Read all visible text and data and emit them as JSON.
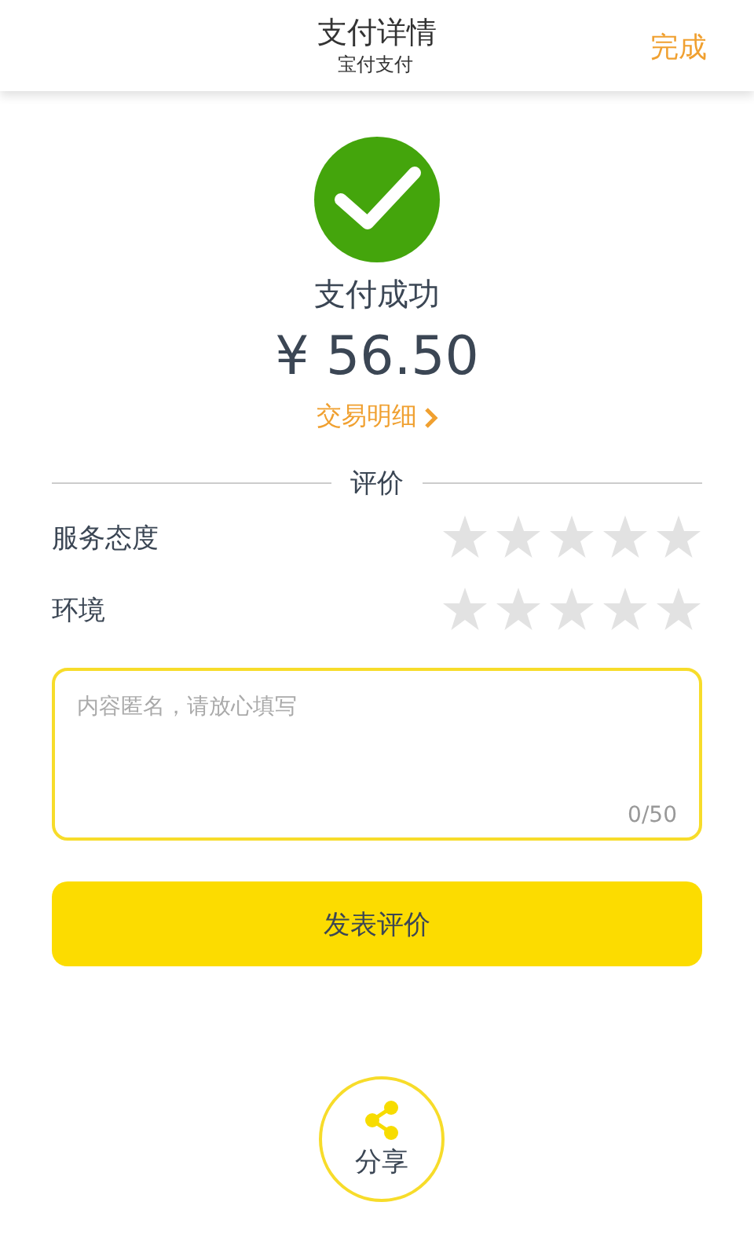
{
  "header": {
    "title": "支付详情",
    "subtitle": "宝付支付",
    "done": "完成"
  },
  "result": {
    "status": "支付成功",
    "amount": "¥ 56.50",
    "details_link": "交易明细"
  },
  "rating": {
    "heading": "评价",
    "rows": [
      {
        "label": "服务态度",
        "stars": 0
      },
      {
        "label": "环境",
        "stars": 0
      }
    ]
  },
  "comment": {
    "placeholder": "内容匿名，请放心填写",
    "counter": "0/50"
  },
  "submit": "发表评价",
  "share": "分享"
}
